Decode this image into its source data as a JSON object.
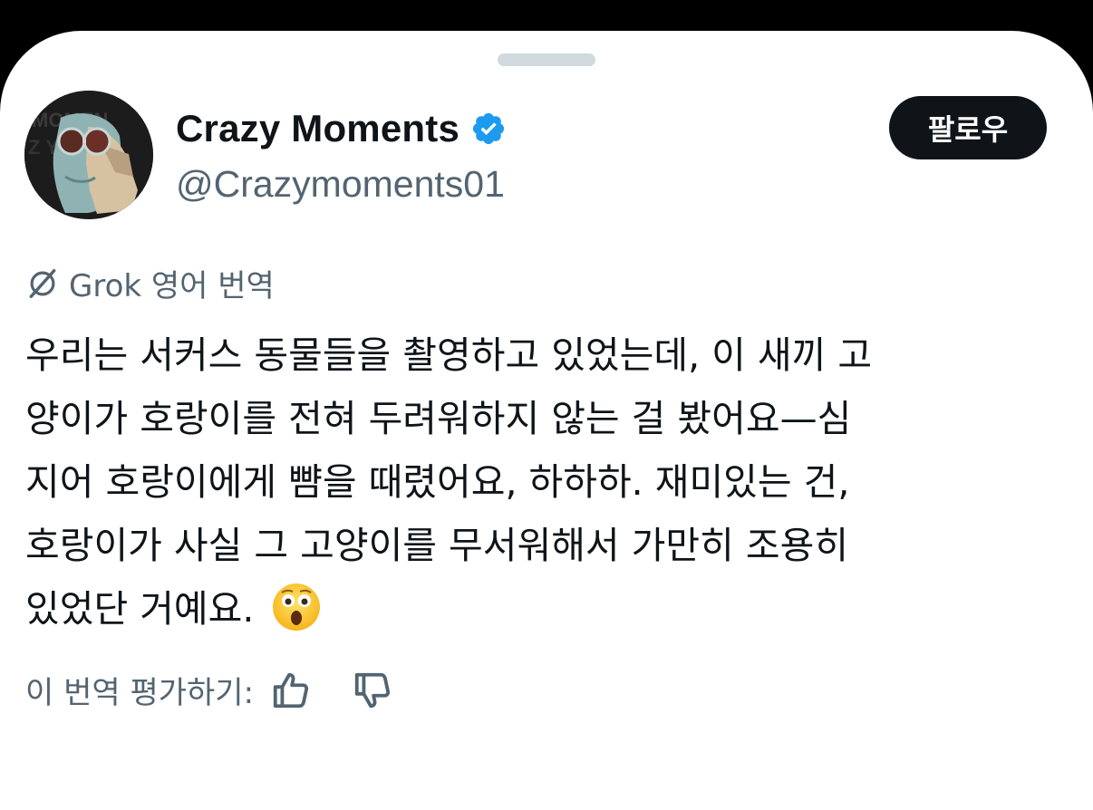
{
  "profile": {
    "name": "Crazy Moments",
    "handle": "@Crazymoments01",
    "verified": true,
    "avatar_icon": "avatar-image"
  },
  "follow_button": {
    "label": "팔로우"
  },
  "translation": {
    "label": "Grok 영어 번역",
    "icon": "grok-icon"
  },
  "tweet": {
    "text": "우리는 서커스 동물들을 촬영하고 있었는데, 이 새끼 고\n양이가 호랑이를 전혀 두려워하지 않는 걸 봤어요—심\n지어 호랑이에게 뺨을 때렸어요, 하하하. 재미있는 건,\n호랑이가 사실 그 고양이를 무서워해서 가만히 조용히\n있었단 거예요.",
    "emoji": "😲"
  },
  "rating": {
    "label": "이 번역 평가하기:",
    "thumbs_up_icon": "thumbs-up-icon",
    "thumbs_down_icon": "thumbs-down-icon"
  },
  "colors": {
    "text_primary": "#0f1419",
    "text_secondary": "#536471",
    "verified_blue": "#1d9bf0",
    "button_bg": "#0f1419"
  }
}
